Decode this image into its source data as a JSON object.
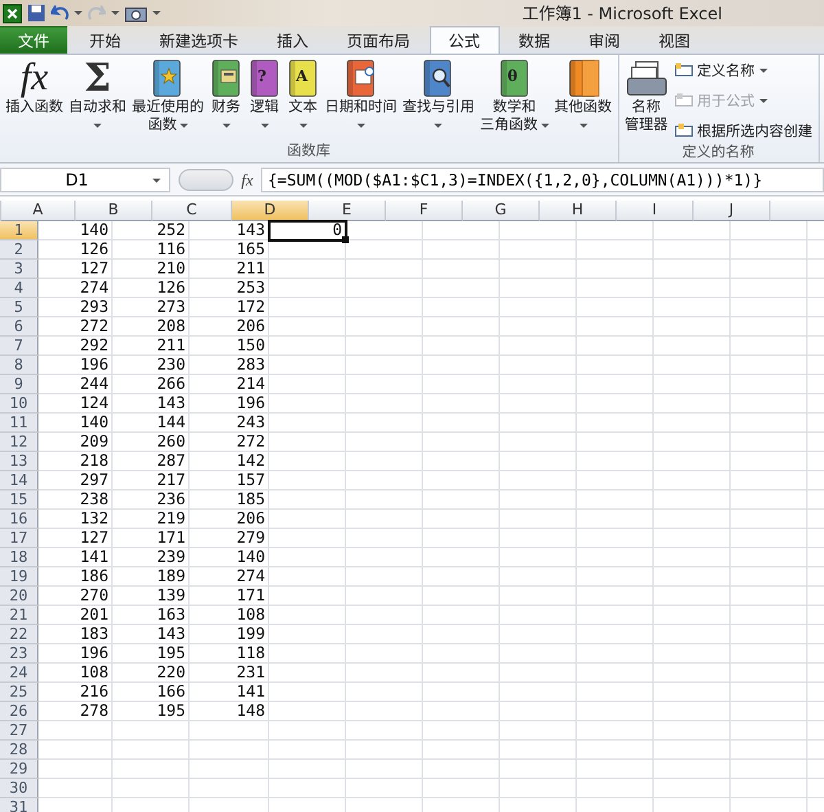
{
  "window": {
    "title": "工作簿1 - Microsoft Excel"
  },
  "tabs": [
    {
      "label": "文件",
      "kind": "file",
      "selected": false
    },
    {
      "label": "开始",
      "kind": "tab",
      "selected": false
    },
    {
      "label": "新建选项卡",
      "kind": "tab",
      "selected": false
    },
    {
      "label": "插入",
      "kind": "tab",
      "selected": false
    },
    {
      "label": "页面布局",
      "kind": "tab",
      "selected": false
    },
    {
      "label": "公式",
      "kind": "tab",
      "selected": true
    },
    {
      "label": "数据",
      "kind": "tab",
      "selected": false
    },
    {
      "label": "审阅",
      "kind": "tab",
      "selected": false
    },
    {
      "label": "视图",
      "kind": "tab",
      "selected": false
    }
  ],
  "ribbon": {
    "groups": [
      {
        "label": "函数库",
        "buttons": [
          {
            "lines": [
              "插入函数"
            ],
            "kind": "fx",
            "glyph": "fx",
            "dropdown": false
          },
          {
            "lines": [
              "自动求和"
            ],
            "kind": "sigma",
            "glyph": "Σ",
            "dropdown": true
          },
          {
            "lines": [
              "最近使用的",
              "函数"
            ],
            "kind": "book",
            "icon": {
              "kind": "star",
              "color": "#5aa8dc"
            },
            "dropdown": true
          },
          {
            "lines": [
              "财务"
            ],
            "kind": "book",
            "icon": {
              "kind": "calc",
              "color": "#5fae5c"
            },
            "dropdown": true
          },
          {
            "lines": [
              "逻辑"
            ],
            "kind": "book",
            "icon": {
              "kind": "glyph",
              "glyph": "?",
              "color": "#b05bbf"
            },
            "dropdown": true
          },
          {
            "lines": [
              "文本"
            ],
            "kind": "book",
            "icon": {
              "kind": "glyph",
              "glyph": "A",
              "color": "#e8e04a"
            },
            "dropdown": true
          },
          {
            "lines": [
              "日期和时间"
            ],
            "kind": "book",
            "icon": {
              "kind": "clock",
              "color": "#e8663a"
            },
            "dropdown": true
          },
          {
            "lines": [
              "查找与引用"
            ],
            "kind": "book",
            "icon": {
              "kind": "lens",
              "color": "#4f86c9"
            },
            "dropdown": true
          },
          {
            "lines": [
              "数学和",
              "三角函数"
            ],
            "kind": "book",
            "icon": {
              "kind": "glyph",
              "glyph": "θ",
              "color": "#5fae5c"
            },
            "dropdown": true
          },
          {
            "lines": [
              "其他函数"
            ],
            "kind": "book",
            "icon": {
              "kind": "stack",
              "color": "#f08a24"
            },
            "dropdown": true
          }
        ]
      },
      {
        "label": "定义的名称",
        "buttons": [
          {
            "lines": [
              "名称",
              "管理器"
            ],
            "kind": "cards",
            "dropdown": false
          }
        ],
        "small_buttons": [
          {
            "label": "定义名称",
            "dropdown": true,
            "disabled": false
          },
          {
            "label": "用于公式",
            "dropdown": true,
            "disabled": true
          },
          {
            "label": "根据所选内容创建",
            "dropdown": false,
            "disabled": false
          }
        ]
      }
    ]
  },
  "formula_bar": {
    "name_box": "D1",
    "fx": "fx",
    "formula": "{=SUM((MOD($A1:$C1,3)=INDEX({1,2,0},COLUMN(A1)))*1)}"
  },
  "sheet": {
    "columns": [
      {
        "label": "A",
        "selected": false
      },
      {
        "label": "B",
        "selected": false
      },
      {
        "label": "C",
        "selected": false
      },
      {
        "label": "D",
        "selected": true
      },
      {
        "label": "E",
        "selected": false
      },
      {
        "label": "F",
        "selected": false
      },
      {
        "label": "G",
        "selected": false
      },
      {
        "label": "H",
        "selected": false
      },
      {
        "label": "I",
        "selected": false
      },
      {
        "label": "J",
        "selected": false
      }
    ],
    "rows": [
      {
        "header": "1",
        "selected": true,
        "cells": [
          "140",
          "252",
          "143",
          "0"
        ]
      },
      {
        "header": "2",
        "selected": false,
        "cells": [
          "126",
          "116",
          "165"
        ]
      },
      {
        "header": "3",
        "selected": false,
        "cells": [
          "127",
          "210",
          "211"
        ]
      },
      {
        "header": "4",
        "selected": false,
        "cells": [
          "274",
          "126",
          "253"
        ]
      },
      {
        "header": "5",
        "selected": false,
        "cells": [
          "293",
          "273",
          "172"
        ]
      },
      {
        "header": "6",
        "selected": false,
        "cells": [
          "272",
          "208",
          "206"
        ]
      },
      {
        "header": "7",
        "selected": false,
        "cells": [
          "292",
          "211",
          "150"
        ]
      },
      {
        "header": "8",
        "selected": false,
        "cells": [
          "196",
          "230",
          "283"
        ]
      },
      {
        "header": "9",
        "selected": false,
        "cells": [
          "244",
          "266",
          "214"
        ]
      },
      {
        "header": "10",
        "selected": false,
        "cells": [
          "124",
          "143",
          "196"
        ]
      },
      {
        "header": "11",
        "selected": false,
        "cells": [
          "140",
          "144",
          "243"
        ]
      },
      {
        "header": "12",
        "selected": false,
        "cells": [
          "209",
          "260",
          "272"
        ]
      },
      {
        "header": "13",
        "selected": false,
        "cells": [
          "218",
          "287",
          "142"
        ]
      },
      {
        "header": "14",
        "selected": false,
        "cells": [
          "297",
          "217",
          "157"
        ]
      },
      {
        "header": "15",
        "selected": false,
        "cells": [
          "238",
          "236",
          "185"
        ]
      },
      {
        "header": "16",
        "selected": false,
        "cells": [
          "132",
          "219",
          "206"
        ]
      },
      {
        "header": "17",
        "selected": false,
        "cells": [
          "127",
          "171",
          "279"
        ]
      },
      {
        "header": "18",
        "selected": false,
        "cells": [
          "141",
          "239",
          "140"
        ]
      },
      {
        "header": "19",
        "selected": false,
        "cells": [
          "186",
          "189",
          "274"
        ]
      },
      {
        "header": "20",
        "selected": false,
        "cells": [
          "270",
          "139",
          "171"
        ]
      },
      {
        "header": "21",
        "selected": false,
        "cells": [
          "201",
          "163",
          "108"
        ]
      },
      {
        "header": "22",
        "selected": false,
        "cells": [
          "183",
          "143",
          "199"
        ]
      },
      {
        "header": "23",
        "selected": false,
        "cells": [
          "196",
          "195",
          "118"
        ]
      },
      {
        "header": "24",
        "selected": false,
        "cells": [
          "108",
          "220",
          "231"
        ]
      },
      {
        "header": "25",
        "selected": false,
        "cells": [
          "216",
          "166",
          "141"
        ]
      },
      {
        "header": "26",
        "selected": false,
        "cells": [
          "278",
          "195",
          "148"
        ]
      },
      {
        "header": "27",
        "selected": false,
        "cells": []
      },
      {
        "header": "28",
        "selected": false,
        "cells": []
      },
      {
        "header": "29",
        "selected": false,
        "cells": []
      },
      {
        "header": "30",
        "selected": false,
        "cells": []
      },
      {
        "header": "31",
        "selected": false,
        "cells": []
      }
    ]
  }
}
